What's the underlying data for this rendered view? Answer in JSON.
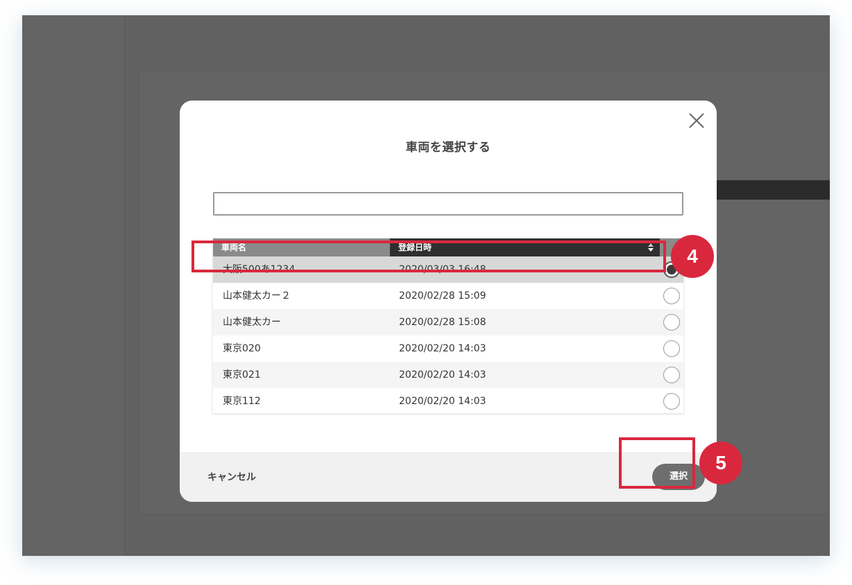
{
  "modal": {
    "title": "車両を選択する",
    "search": {
      "value": "",
      "placeholder": ""
    },
    "table": {
      "columns": [
        "車両名",
        "登録日時"
      ],
      "rows": [
        {
          "name": "大阪500あ1234",
          "date": "2020/03/03 16:48",
          "selected": true
        },
        {
          "name": "山本健太カー２",
          "date": "2020/02/28 15:09",
          "selected": false
        },
        {
          "name": "山本健太カー",
          "date": "2020/02/28 15:08",
          "selected": false
        },
        {
          "name": "東京020",
          "date": "2020/02/20 14:03",
          "selected": false
        },
        {
          "name": "東京021",
          "date": "2020/02/20 14:03",
          "selected": false
        },
        {
          "name": "東京112",
          "date": "2020/02/20 14:03",
          "selected": false
        }
      ]
    },
    "footer": {
      "cancel_label": "キャンセル",
      "select_label": "選択"
    }
  },
  "annotations": {
    "step4": "4",
    "step5": "5"
  },
  "colors": {
    "accent": "#d9283d",
    "select_button": "#6e6e6e",
    "header_dark": "#2f2f2f",
    "header_light": "#8a8a8a"
  },
  "icons": {
    "close": "close-icon",
    "sort": "sort-icon"
  }
}
